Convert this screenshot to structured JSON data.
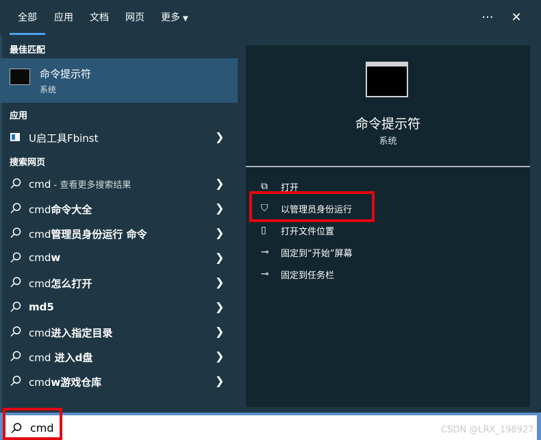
{
  "tabs": [
    {
      "label": "全部",
      "active": true
    },
    {
      "label": "应用"
    },
    {
      "label": "文档"
    },
    {
      "label": "网页"
    },
    {
      "label": "更多"
    }
  ],
  "window_controls": {
    "more": "···",
    "close": "✕"
  },
  "left": {
    "best_match_header": "最佳匹配",
    "best_match": {
      "title": "命令提示符",
      "subtitle": "系统"
    },
    "apps_header": "应用",
    "apps": [
      {
        "label": "U启工具Fbinst"
      }
    ],
    "web_header": "搜索网页",
    "web_results": [
      {
        "prefix": "cmd",
        "rest": " - 查看更多搜索结果",
        "bold_rest": false
      },
      {
        "prefix": "cmd",
        "rest": "命令大全",
        "bold_rest": true
      },
      {
        "prefix": "cmd",
        "rest": "管理员身份运行 命令",
        "bold_rest": true
      },
      {
        "prefix": "cmd",
        "rest": "w",
        "bold_rest": true
      },
      {
        "prefix": "cmd",
        "rest": "怎么打开",
        "bold_rest": true
      },
      {
        "prefix": "",
        "rest": "md5",
        "bold_rest": true
      },
      {
        "prefix": "cmd",
        "rest": "进入指定目录",
        "bold_rest": true
      },
      {
        "prefix": "cmd",
        "rest": " 进入d盘",
        "bold_rest": true
      },
      {
        "prefix": "cmd",
        "rest": "w游戏仓库",
        "bold_rest": true
      }
    ]
  },
  "right": {
    "title": "命令提示符",
    "subtitle": "系统",
    "actions": [
      {
        "label": "打开",
        "icon": "open-icon"
      },
      {
        "label": "以管理员身份运行",
        "icon": "shield-icon"
      },
      {
        "label": "打开文件位置",
        "icon": "file-location-icon"
      },
      {
        "label": "固定到“开始”屏幕",
        "icon": "pin-icon"
      },
      {
        "label": "固定到任务栏",
        "icon": "pin-icon"
      }
    ]
  },
  "search": {
    "value": "cmd"
  },
  "watermark": "CSDN @LRX_198927",
  "colors": {
    "highlight": "#2b5675",
    "annotation": "#e30613",
    "tab_underline": "#4ea1f0"
  }
}
